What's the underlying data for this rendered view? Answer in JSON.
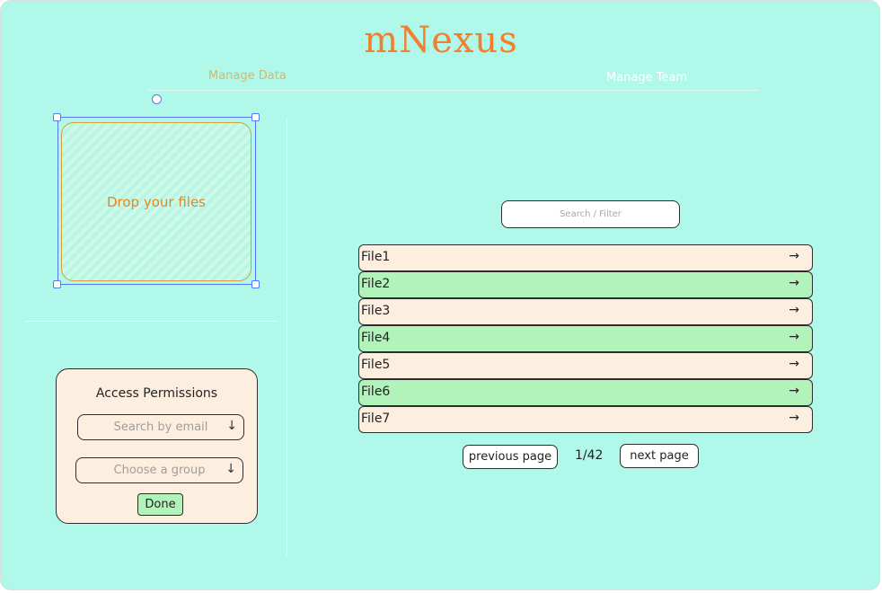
{
  "app": {
    "title": "mNexus"
  },
  "nav": {
    "manage_data": "Manage Data",
    "manage_team": "Manage Team"
  },
  "dropzone": {
    "label": "Drop your files"
  },
  "permissions": {
    "title": "Access Permissions",
    "email_placeholder": "Search by email",
    "group_placeholder": "Choose a group",
    "dropdown_icon": "arrow-down-icon",
    "done_label": "Done"
  },
  "search": {
    "placeholder": "Search / Filter"
  },
  "files": [
    {
      "name": "File1",
      "color": "#fdefe0"
    },
    {
      "name": "File2",
      "color": "#b2f2bb"
    },
    {
      "name": "File3",
      "color": "#fdefe0"
    },
    {
      "name": "File4",
      "color": "#b2f2bb"
    },
    {
      "name": "File5",
      "color": "#fdefe0"
    },
    {
      "name": "File6",
      "color": "#b2f2bb"
    },
    {
      "name": "File7",
      "color": "#fdefe0"
    }
  ],
  "file_row_icon": "arrow-right-icon",
  "pagination": {
    "previous_label": "previous page",
    "page_indicator": "1/42",
    "next_label": "next page"
  },
  "colors": {
    "background": "#aff8ea",
    "accent": "#f07f2e",
    "row_cream": "#fdefe0",
    "row_green": "#b2f2bb"
  }
}
